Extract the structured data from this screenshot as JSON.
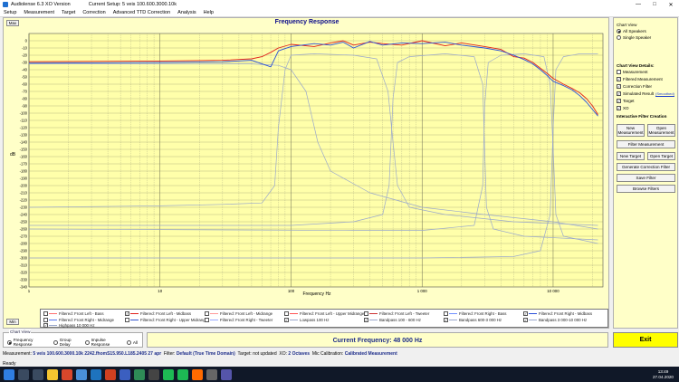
{
  "window": {
    "app_title": "Audiolense 6.3 XO Version",
    "setup_title": "Current Setup: 5 veis 100.600.3000.10k",
    "controls": [
      "—",
      "□",
      "✕"
    ]
  },
  "menu": [
    "Setup",
    "Measurement",
    "Target",
    "Correction",
    "Advanced TTD Correction",
    "Analysis",
    "Help"
  ],
  "chart": {
    "max_label": "Max",
    "min_label": "Min",
    "colors": {
      "red": "#e0201a",
      "blue": "#2a4fd8",
      "grey": "#9aa8cc"
    }
  },
  "chart_data": {
    "type": "line",
    "title": "Frequency Response",
    "xlabel": "Frequency Hz",
    "ylabel": "dB",
    "x_scale": "log",
    "xlim": [
      1,
      24000
    ],
    "ylim": [
      -340,
      10
    ],
    "x_ticks": [
      1,
      10,
      100,
      1000,
      10000
    ],
    "x_tick_labels": [
      "1",
      "10",
      "100",
      "1 000",
      "10 000"
    ],
    "y_ticks": [
      0,
      -10,
      -20,
      -30,
      -40,
      -50,
      -60,
      -70,
      -80,
      -90,
      -100,
      -110,
      -120,
      -130,
      -140,
      -150,
      -160,
      -170,
      -180,
      -190,
      -200,
      -210,
      -220,
      -230,
      -240,
      -250,
      -260,
      -270,
      -280,
      -290,
      -300,
      -310,
      -320,
      -330,
      -340
    ],
    "series": [
      {
        "name": "Filtered: Front Left - Midbass",
        "color": "#e0201a",
        "x": [
          1,
          10,
          30,
          50,
          60,
          70,
          80,
          100,
          150,
          200,
          250,
          300,
          400,
          500,
          700,
          1000,
          1500,
          2000,
          3000,
          4000,
          5000,
          6000,
          7000,
          8000,
          9000,
          10000,
          12000,
          14000,
          16000,
          18000,
          20000,
          22000
        ],
        "y": [
          -29,
          -28,
          -27,
          -25,
          -22,
          -16,
          -10,
          -5,
          -8,
          -3,
          0,
          -6,
          -2,
          -4,
          -6,
          0,
          -7,
          -3,
          -8,
          -12,
          -22,
          -24,
          -30,
          -38,
          -45,
          -52,
          -60,
          -66,
          -72,
          -80,
          -90,
          -102
        ]
      },
      {
        "name": "Filtered: Front Right - Midbass",
        "color": "#2a4fd8",
        "x": [
          1,
          10,
          30,
          50,
          60,
          70,
          80,
          100,
          150,
          200,
          250,
          300,
          400,
          500,
          700,
          1000,
          1500,
          2000,
          3000,
          4000,
          5000,
          6000,
          7000,
          8000,
          9000,
          10000,
          12000,
          14000,
          16000,
          18000,
          20000,
          22000
        ],
        "y": [
          -31,
          -30,
          -29,
          -27,
          -32,
          -36,
          -14,
          -8,
          -4,
          -6,
          -2,
          -10,
          -1,
          -6,
          -3,
          -4,
          -2,
          -6,
          -10,
          -14,
          -20,
          -26,
          -32,
          -40,
          -48,
          -56,
          -62,
          -68,
          -76,
          -85,
          -95,
          -104
        ]
      },
      {
        "name": "Lowpass 100 Hz",
        "color": "#9aa8cc",
        "x": [
          1,
          10,
          50,
          80,
          100,
          130,
          160,
          200,
          400,
          1000,
          3000,
          10000,
          22000
        ],
        "y": [
          -32,
          -32,
          -32,
          -34,
          -40,
          -70,
          -140,
          -180,
          -210,
          -230,
          -240,
          -250,
          -260
        ]
      },
      {
        "name": "Bandpass 100-600 Hz",
        "color": "#9aa8cc",
        "x": [
          1,
          10,
          30,
          60,
          75,
          80,
          90,
          100,
          150,
          300,
          450,
          550,
          600,
          650,
          800,
          1500,
          5000,
          22000
        ],
        "y": [
          -230,
          -228,
          -226,
          -224,
          -200,
          -120,
          -40,
          -20,
          -18,
          -20,
          -25,
          -70,
          -140,
          -200,
          -230,
          -240,
          -250,
          -255
        ]
      },
      {
        "name": "Bandpass 600-3 000 Hz",
        "color": "#9aa8cc",
        "x": [
          1,
          100,
          300,
          500,
          560,
          600,
          650,
          800,
          1500,
          2500,
          2900,
          3000,
          3100,
          3500,
          6000,
          22000
        ],
        "y": [
          -255,
          -255,
          -250,
          -240,
          -200,
          -80,
          -30,
          -22,
          -18,
          -22,
          -60,
          -150,
          -230,
          -260,
          -270,
          -275
        ]
      },
      {
        "name": "Bandpass 3 000-10 000 Hz",
        "color": "#9aa8cc",
        "x": [
          1,
          300,
          1000,
          2500,
          2900,
          3000,
          3200,
          4000,
          6000,
          8500,
          9500,
          10000,
          10500,
          12000,
          22000
        ],
        "y": [
          -260,
          -262,
          -262,
          -255,
          -200,
          -90,
          -30,
          -20,
          -18,
          -22,
          -60,
          -150,
          -240,
          -270,
          -280
        ]
      },
      {
        "name": "Highpass 10 000 Hz",
        "color": "#9aa8cc",
        "x": [
          1,
          1000,
          5000,
          8000,
          9500,
          10000,
          10500,
          12000,
          16000,
          22000
        ],
        "y": [
          -300,
          -300,
          -298,
          -290,
          -240,
          -120,
          -40,
          -22,
          -18,
          -18
        ]
      }
    ]
  },
  "legend": [
    {
      "label": "Filtered: Front Left - Bass",
      "checked": false,
      "color": "#ff7070"
    },
    {
      "label": "Filtered: Front Left - Midbass",
      "checked": true,
      "color": "#e0201a"
    },
    {
      "label": "Filtered: Front Left - Midrange",
      "checked": false,
      "color": "#ff9999"
    },
    {
      "label": "Filtered: Front Left - Upper Midrange",
      "checked": false,
      "color": "#ff5555"
    },
    {
      "label": "Filtered: Front Left - Tweeter",
      "checked": false,
      "color": "#cc3333"
    },
    {
      "label": "Filtered: Front Right - Bass",
      "checked": false,
      "color": "#7090ff"
    },
    {
      "label": "Filtered: Front Right - Midbass",
      "checked": true,
      "color": "#2a4fd8"
    },
    {
      "label": "Filtered: Front Right - Midrange",
      "checked": false,
      "color": "#5577ee"
    },
    {
      "label": "Filtered: Front Right - Upper Midrange",
      "checked": false,
      "color": "#3355cc"
    },
    {
      "label": "Filtered: Front Right - Tweeter",
      "checked": false,
      "color": "#99aaff"
    },
    {
      "label": "Lowpass 100 Hz",
      "checked": true,
      "color": "#9aa8cc"
    },
    {
      "label": "Bandpass 100 - 600 Hz",
      "checked": true,
      "color": "#9aa8cc"
    },
    {
      "label": "Bandpass 600-3 000 Hz",
      "checked": true,
      "color": "#9aa8cc"
    },
    {
      "label": "Bandpass 3 000-10 000 Hz",
      "checked": true,
      "color": "#9aa8cc"
    },
    {
      "label": "Highpass 10 000 Hz",
      "checked": true,
      "color": "#9aa8cc"
    }
  ],
  "side": {
    "chart_view_title": "Chart View",
    "view_options": [
      {
        "label": "All Speakers",
        "selected": true
      },
      {
        "label": "Single Speaker",
        "selected": false
      }
    ],
    "details_title": "Chart View Details:",
    "details": [
      {
        "label": "Measurement",
        "checked": false
      },
      {
        "label": "Filtered Measurement",
        "checked": true
      },
      {
        "label": "Correction Filter",
        "checked": true
      },
      {
        "label": "Simulated Result",
        "checked": true,
        "link": "Smoothed"
      },
      {
        "label": "Target",
        "checked": true
      },
      {
        "label": "XO",
        "checked": true
      }
    ],
    "filter_title": "Interactive Filter Creation",
    "buttons": {
      "new_measurement": "New Measurement",
      "open_measurement": "Open Measurement",
      "filter_measurement": "Filter Measurement",
      "new_target": "New Target",
      "open_target": "Open Target",
      "generate": "Generate Correction Filter",
      "save_filter": "Save Filter",
      "browse_filters": "Browse Filters"
    }
  },
  "bottom": {
    "chart_view_label": "Chart View",
    "view_modes": [
      {
        "label": "Frequency Response",
        "selected": true
      },
      {
        "label": "Group Delay",
        "selected": false
      },
      {
        "label": "Impulse Response",
        "selected": false
      },
      {
        "label": "All",
        "selected": false
      }
    ],
    "current_frequency": "Current Frequency: 48 000 Hz",
    "exit": "Exit"
  },
  "status": {
    "measurement_label": "Measurement:",
    "measurement_value": "5 veis 100.600.3000.10k 2242.fhomS15.950.L185.2405 27 apr",
    "filter_label": "Filter:",
    "filter_value": "Default (True Time Domain)",
    "target_label": "Target:",
    "target_value": "not updated",
    "xo_label": "XO:",
    "xo_value": "2 Octaves",
    "mic_label": "Mic Calibration:",
    "mic_value": "Calibrated Measurement",
    "ready": "Ready"
  },
  "taskbar": {
    "time": "13:49",
    "date": "27.04.2020"
  }
}
